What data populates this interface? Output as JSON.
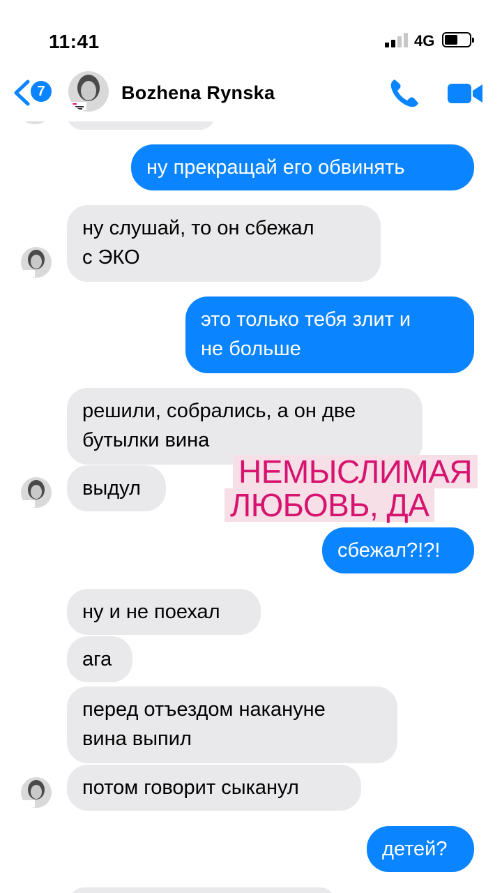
{
  "status_bar": {
    "time": "11:41",
    "network": "4G",
    "battery_icon": "battery-icon",
    "signal_icon": "signal-icon"
  },
  "header": {
    "back_icon": "chevron-left-icon",
    "unread_count": "7",
    "contact_name": "Bozhena  Rynska",
    "call_icon": "phone-icon",
    "video_icon": "video-camera-icon",
    "accent_color": "#0a84ff"
  },
  "messages": [
    {
      "direction": "out",
      "text": "ну прекращай его обвинять"
    },
    {
      "direction": "in",
      "lines": [
        "ну слушай, то он сбежал",
        "с ЭКО"
      ]
    },
    {
      "direction": "out",
      "lines": [
        "это только тебя злит и",
        "не больше"
      ]
    },
    {
      "direction": "in",
      "lines": [
        "решили, собрались, а он две",
        "бутылки вина"
      ]
    },
    {
      "direction": "in",
      "text": "выдул"
    },
    {
      "direction": "out",
      "text": "сбежал?!?!"
    },
    {
      "direction": "in",
      "text": "ну и не поехал"
    },
    {
      "direction": "in",
      "text": "ага"
    },
    {
      "direction": "in",
      "lines": [
        "перед отъездом накануне",
        "вина выпил"
      ]
    },
    {
      "direction": "in",
      "text": "потом говорит сыканул"
    },
    {
      "direction": "out",
      "text": "детей?"
    }
  ],
  "sticker": {
    "lines": [
      "НЕМЫСЛИМАЯ",
      "ЛЮБОВЬ, ДА"
    ],
    "text_color": "#d6136f",
    "background": "#f6dfe7"
  },
  "colors": {
    "incoming_bubble": "#e9e9eb",
    "outgoing_bubble": "#0a84ff"
  }
}
